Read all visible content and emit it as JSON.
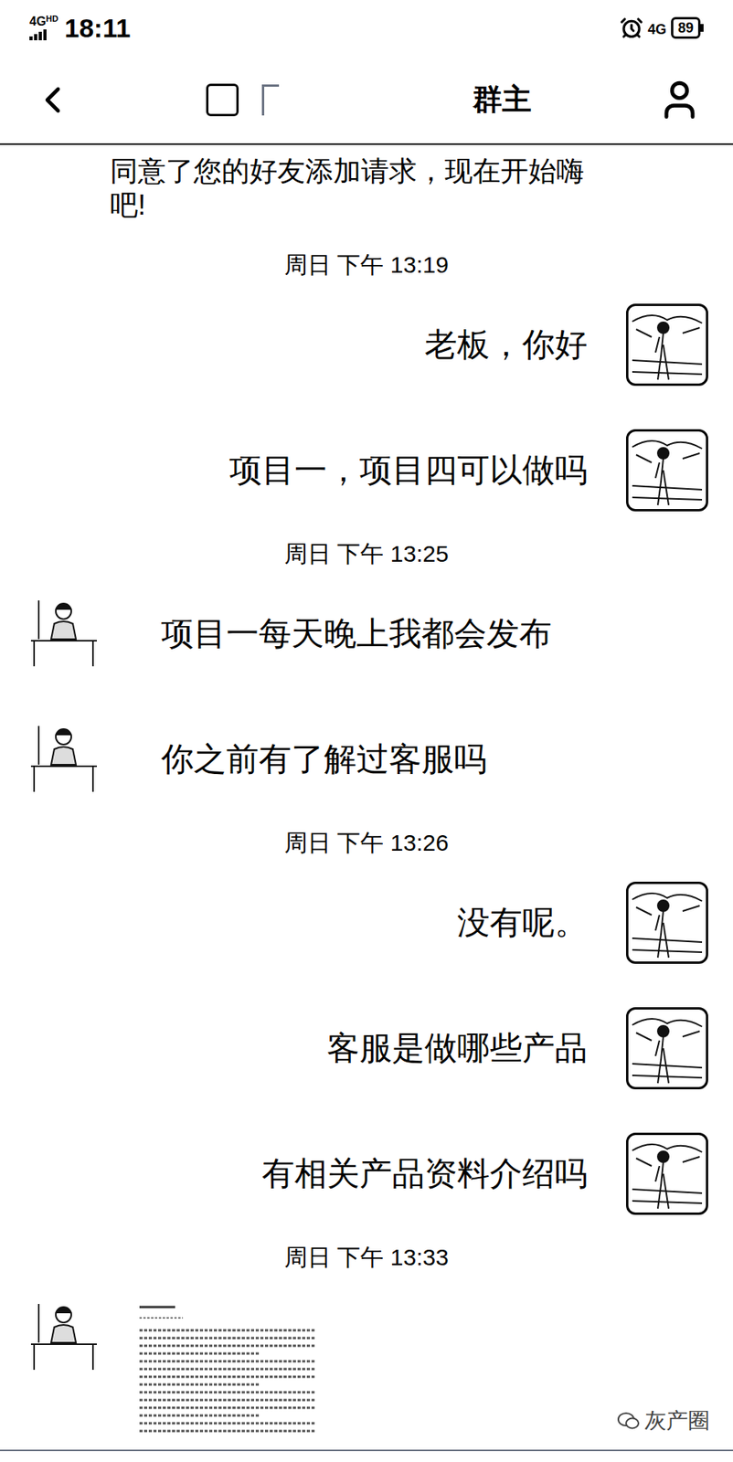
{
  "status_bar": {
    "network_left": "4G",
    "hd": "HD",
    "time": "18:11",
    "network_right": "4G",
    "battery": "89"
  },
  "nav": {
    "title": "群主"
  },
  "system_message": "同意了您的好友添加请求，现在开始嗨吧!",
  "messages": [
    {
      "kind": "time",
      "text": "周日 下午 13:19"
    },
    {
      "kind": "text",
      "from": "me",
      "text": "老板，你好"
    },
    {
      "kind": "text",
      "from": "me",
      "text": "项目一，项目四可以做吗"
    },
    {
      "kind": "time",
      "text": "周日 下午 13:25"
    },
    {
      "kind": "text",
      "from": "other",
      "text": "项目一每天晚上我都会发布"
    },
    {
      "kind": "text",
      "from": "other",
      "text": "你之前有了解过客服吗"
    },
    {
      "kind": "time",
      "text": "周日 下午 13:26"
    },
    {
      "kind": "text",
      "from": "me",
      "text": "没有呢。"
    },
    {
      "kind": "text",
      "from": "me",
      "text": "客服是做哪些产品"
    },
    {
      "kind": "text",
      "from": "me",
      "text": "有相关产品资料介绍吗"
    },
    {
      "kind": "time",
      "text": "周日 下午 13:33"
    },
    {
      "kind": "image",
      "from": "other"
    }
  ],
  "watermark": "灰产圈"
}
